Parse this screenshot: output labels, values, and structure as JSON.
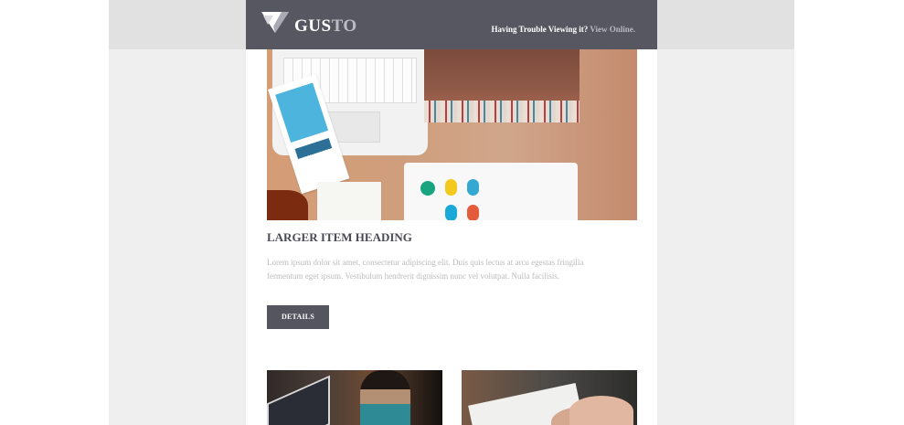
{
  "email": {
    "logo": {
      "icon": "gusto-logo-icon",
      "text_part_1": "GUS",
      "text_part_2": "TO"
    },
    "header_notice": {
      "prefix": "Having Trouble Viewing it?",
      "link": "View Online."
    },
    "featured": {
      "image_name": "desk-workspace-image",
      "heading": "LARGER ITEM HEADING",
      "body": "Lorem ipsum dolor sit amet, consectetur adipiscing elit. Duis quis lectus at arcu egestas fringilla fermentum eget ipsum. Vestibulum hendrerit dignissim nunc vel volutpat. Nulla facilisis.",
      "button_label": "DETAILS"
    },
    "thumbnails": [
      {
        "image_name": "laptop-person-image"
      },
      {
        "image_name": "writing-hands-image"
      }
    ],
    "colors": {
      "header": "#575762",
      "button": "#555560",
      "heading": "#4a4a55",
      "body_text": "#bcbcbc",
      "outer_background": "#efefef",
      "outer_top_band": "#e1e1e1"
    }
  }
}
